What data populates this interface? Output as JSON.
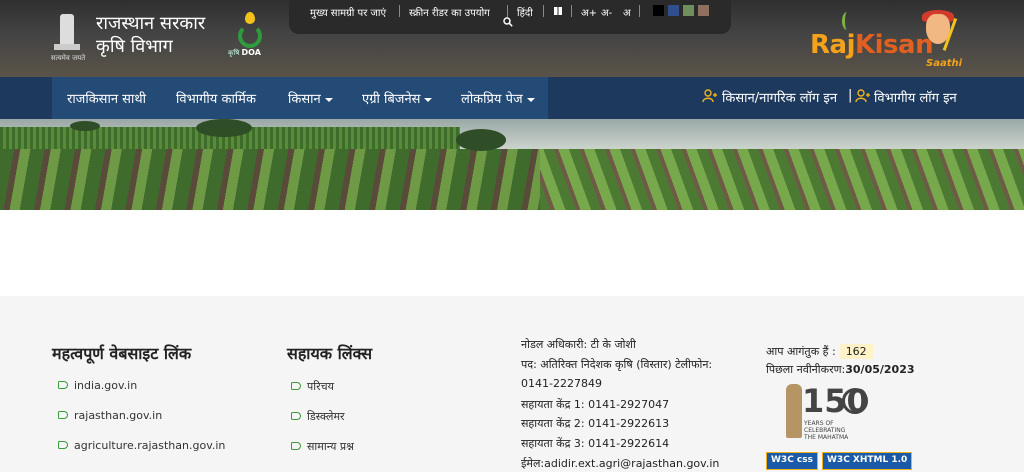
{
  "header": {
    "gov_line1": "राजस्थान सरकार",
    "gov_line2": "कृषि विभाग",
    "emblem_motto": "सत्यमेव जयते",
    "doa_tag_small": "कृषि",
    "doa_tag_big": "DOA",
    "rk_brand_a": "Raj",
    "rk_brand_b": "Kisan",
    "rk_saathi": "Saathi"
  },
  "access_bar": {
    "skip_main": "मुख्य सामग्री पर जाएं",
    "screen_reader": "स्क्रीन रीडर का उपयोग",
    "language": "हिंदी",
    "font_plus": "अ+",
    "font_minus": "अ-",
    "font_reset": "अ",
    "contrast_swatches": [
      "#000000",
      "#2f4f8f",
      "#6f8f5f",
      "#8f6f5f"
    ]
  },
  "nav": {
    "items": [
      {
        "label": "राजकिसान साथी"
      },
      {
        "label": "विभागीय कार्मिक"
      },
      {
        "label": "किसान"
      },
      {
        "label": "एग्री बिजनेस"
      },
      {
        "label": "लोकप्रिय पेज"
      }
    ],
    "farmer_login": "किसान/नागरिक लॉग इन",
    "login_sep": "|",
    "dept_login": "विभागीय लॉग इन"
  },
  "footer": {
    "links_heading": "महत्वपूर्ण वेबसाइट लिंक",
    "links": [
      "india.gov.in",
      "rajasthan.gov.in",
      "agriculture.rajasthan.gov.in"
    ],
    "help_heading": "सहायक लिंक्स",
    "help_links": [
      "परिचय",
      "डिस्क्लेमर",
      "सामान्य प्रश्न"
    ],
    "contact": {
      "nodal_officer": "नोडल अधिकारी: टी के जोशी",
      "designation": "पद: अतिरिक्त निदेशक कृषि (विस्तार) टेलीफोन:",
      "phone": "0141-2227849",
      "help1": "सहायता केंद्र 1: 0141-2927047",
      "help2": "सहायता केंद्र 2: 0141-2922613",
      "help3": "सहायता केंद्र 3: 0141-2922614",
      "email": "ईमेल:adidir.ext.agri@rajasthan.gov.in"
    },
    "visitor_label": "आप आगंतुक हैं :",
    "visitor_count": "162",
    "updated_label": "पिछला नवीनीकरण:",
    "updated_date": "30/05/2023",
    "gandhi_number": "150",
    "gandhi_caption_1": "YEARS OF",
    "gandhi_caption_2": "CELEBRATING",
    "gandhi_caption_3": "THE MAHATMA",
    "w3c_css": "W3C css",
    "w3c_xhtml": "W3C XHTML 1.0"
  }
}
